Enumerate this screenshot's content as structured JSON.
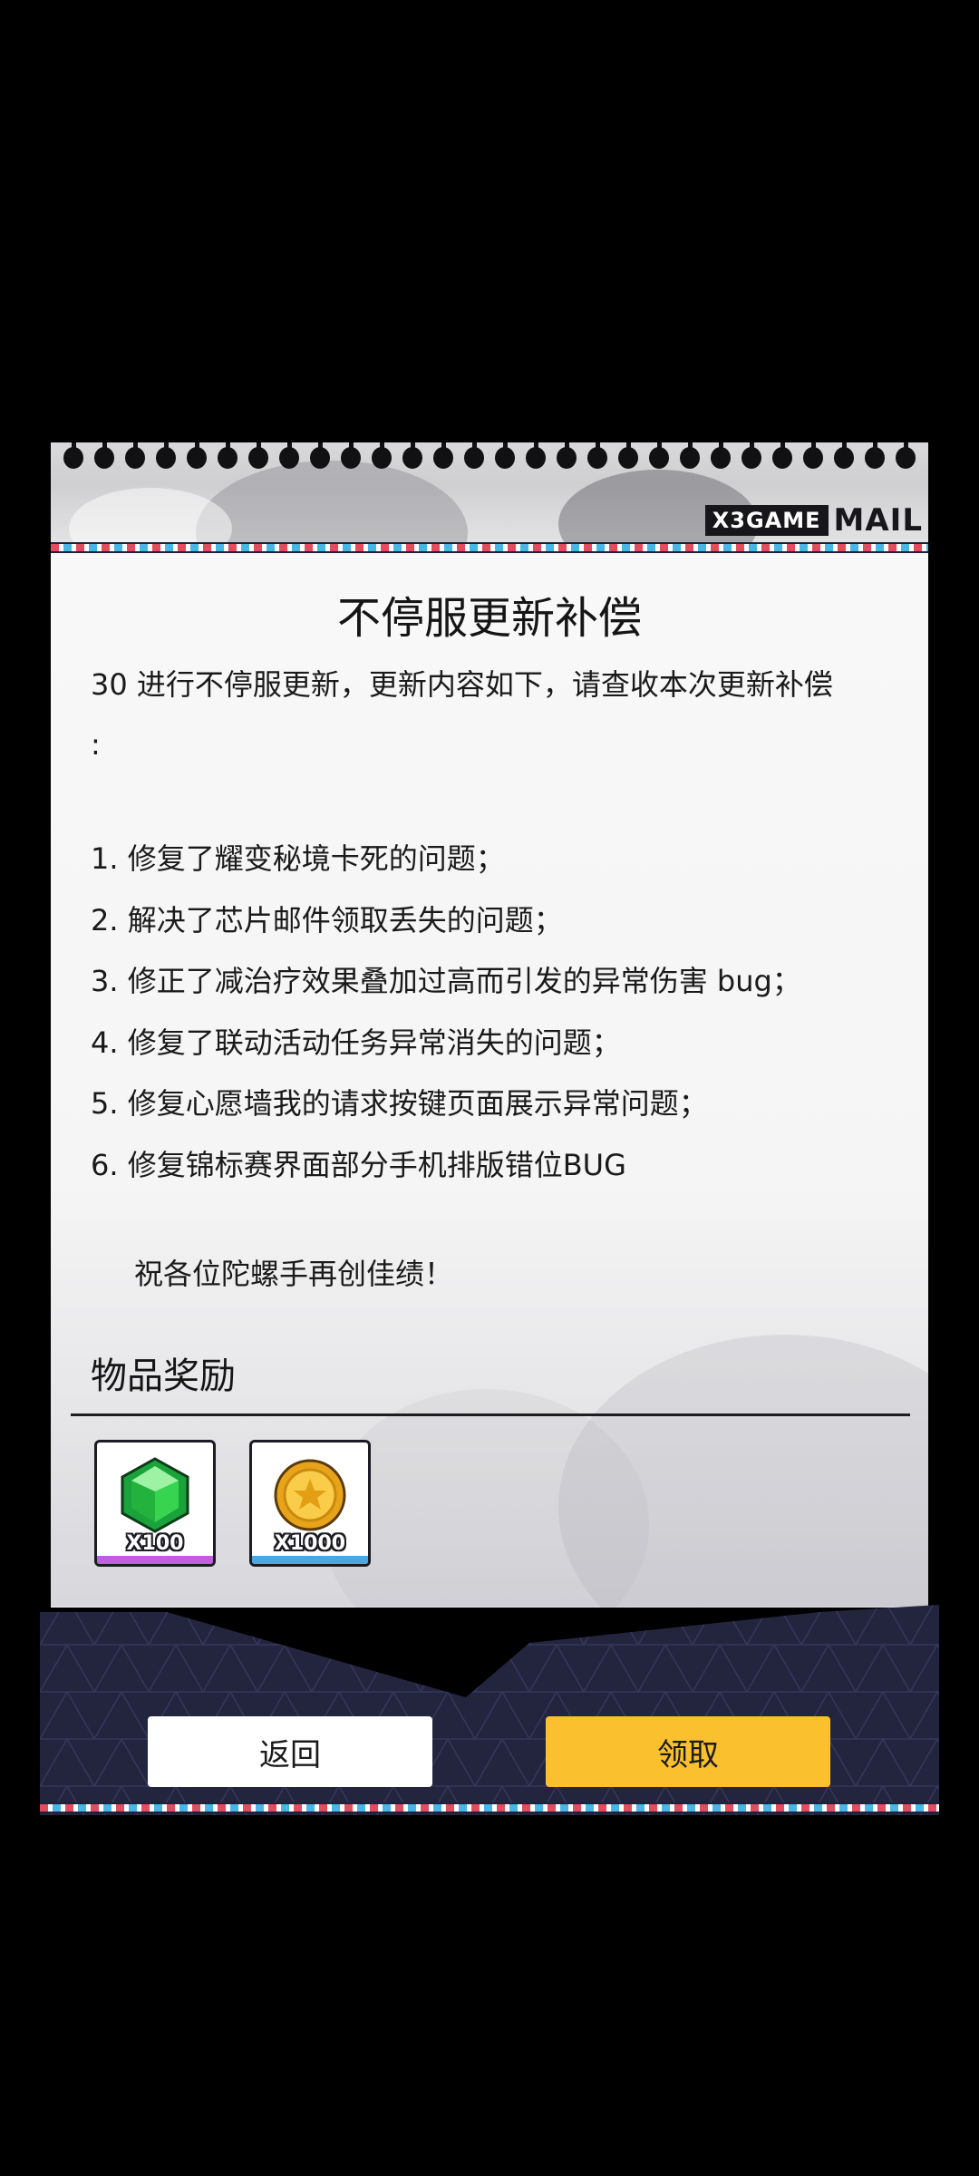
{
  "header": {
    "brand_box": "X3GAME",
    "brand_mail": "MAIL",
    "binder_holes": 28
  },
  "mail": {
    "title": "不停服更新补偿",
    "intro_line1": "30 进行不停服更新，更新内容如下，请查收本次更新补偿",
    "intro_line2": ":",
    "fixes": [
      "1. 修复了耀变秘境卡死的问题；",
      "2. 解决了芯片邮件领取丢失的问题；",
      "3. 修正了减治疗效果叠加过高而引发的异常伤害 bug；",
      "4. 修复了联动活动任务异常消失的问题；",
      "5. 修复心愿墙我的请求按键页面展示异常问题；",
      "6. 修复锦标赛界面部分手机排版错位BUG"
    ],
    "blessing": "祝各位陀螺手再创佳绩！"
  },
  "rewards": {
    "title": "物品奖励",
    "items": [
      {
        "icon": "green-gem-icon",
        "qty": "X100",
        "bar_color": "#c25de0"
      },
      {
        "icon": "gold-coin-icon",
        "qty": "X1000",
        "bar_color": "#4aa7e0"
      }
    ]
  },
  "buttons": {
    "back": "返回",
    "claim": "领取"
  },
  "colors": {
    "accent_yellow": "#fbc02d",
    "footer_navy": "#23253f",
    "stripe_red": "#e44b5d",
    "stripe_blue": "#45b6e6"
  }
}
